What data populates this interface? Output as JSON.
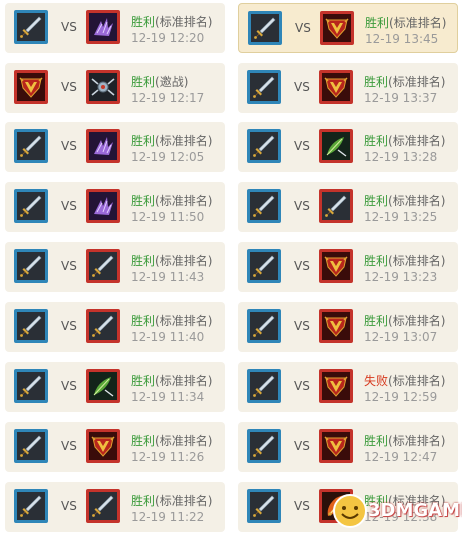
{
  "vs_label": "VS",
  "left_matches": [
    {
      "player_icon": "sword-icon",
      "player_border": "blue",
      "opponent_icon": "purple-claw-icon",
      "opponent_border": "red",
      "result": "胜利",
      "result_type": "win",
      "mode": "(标准排名)",
      "time": "12-19 12:20"
    },
    {
      "player_icon": "horde-crest-icon",
      "player_border": "red",
      "opponent_icon": "mech-spider-icon",
      "opponent_border": "red",
      "result": "胜利",
      "result_type": "win",
      "mode": "(邀战)",
      "time": "12-19 12:17"
    },
    {
      "player_icon": "sword-icon",
      "player_border": "blue",
      "opponent_icon": "purple-claw-icon",
      "opponent_border": "red",
      "result": "胜利",
      "result_type": "win",
      "mode": "(标准排名)",
      "time": "12-19 12:05"
    },
    {
      "player_icon": "sword-icon",
      "player_border": "blue",
      "opponent_icon": "purple-claw-icon",
      "opponent_border": "red",
      "result": "胜利",
      "result_type": "win",
      "mode": "(标准排名)",
      "time": "12-19 11:50"
    },
    {
      "player_icon": "sword-icon",
      "player_border": "blue",
      "opponent_icon": "sword-icon",
      "opponent_border": "red",
      "result": "胜利",
      "result_type": "win",
      "mode": "(标准排名)",
      "time": "12-19 11:43"
    },
    {
      "player_icon": "sword-icon",
      "player_border": "blue",
      "opponent_icon": "sword-icon",
      "opponent_border": "red",
      "result": "胜利",
      "result_type": "win",
      "mode": "(标准排名)",
      "time": "12-19 11:40"
    },
    {
      "player_icon": "sword-icon",
      "player_border": "blue",
      "opponent_icon": "green-leaf-icon",
      "opponent_border": "red",
      "result": "胜利",
      "result_type": "win",
      "mode": "(标准排名)",
      "time": "12-19 11:34"
    },
    {
      "player_icon": "sword-icon",
      "player_border": "blue",
      "opponent_icon": "horde-crest-icon",
      "opponent_border": "red",
      "result": "胜利",
      "result_type": "win",
      "mode": "(标准排名)",
      "time": "12-19 11:26"
    },
    {
      "player_icon": "sword-icon",
      "player_border": "blue",
      "opponent_icon": "sword-icon",
      "opponent_border": "red",
      "result": "胜利",
      "result_type": "win",
      "mode": "(标准排名)",
      "time": "12-19 11:22"
    }
  ],
  "right_matches": [
    {
      "player_icon": "sword-icon",
      "player_border": "blue",
      "opponent_icon": "horde-crest-icon",
      "opponent_border": "red",
      "result": "胜利",
      "result_type": "win",
      "mode": "(标准排名)",
      "time": "12-19 13:45",
      "highlight": true
    },
    {
      "player_icon": "sword-icon",
      "player_border": "blue",
      "opponent_icon": "horde-crest-icon",
      "opponent_border": "red",
      "result": "胜利",
      "result_type": "win",
      "mode": "(标准排名)",
      "time": "12-19 13:37"
    },
    {
      "player_icon": "sword-icon",
      "player_border": "blue",
      "opponent_icon": "green-leaf-icon",
      "opponent_border": "red",
      "result": "胜利",
      "result_type": "win",
      "mode": "(标准排名)",
      "time": "12-19 13:28"
    },
    {
      "player_icon": "sword-icon",
      "player_border": "blue",
      "opponent_icon": "sword-icon",
      "opponent_border": "red",
      "result": "胜利",
      "result_type": "win",
      "mode": "(标准排名)",
      "time": "12-19 13:25"
    },
    {
      "player_icon": "sword-icon",
      "player_border": "blue",
      "opponent_icon": "horde-crest-icon",
      "opponent_border": "red",
      "result": "胜利",
      "result_type": "win",
      "mode": "(标准排名)",
      "time": "12-19 13:23"
    },
    {
      "player_icon": "sword-icon",
      "player_border": "blue",
      "opponent_icon": "horde-crest-icon",
      "opponent_border": "red",
      "result": "胜利",
      "result_type": "win",
      "mode": "(标准排名)",
      "time": "12-19 13:07"
    },
    {
      "player_icon": "sword-icon",
      "player_border": "blue",
      "opponent_icon": "horde-crest-icon",
      "opponent_border": "red",
      "result": "失败",
      "result_type": "loss",
      "mode": "(标准排名)",
      "time": "12-19 12:59"
    },
    {
      "player_icon": "sword-icon",
      "player_border": "blue",
      "opponent_icon": "horde-crest-icon",
      "opponent_border": "red",
      "result": "胜利",
      "result_type": "win",
      "mode": "(标准排名)",
      "time": "12-19 12:47"
    },
    {
      "player_icon": "sword-icon",
      "player_border": "blue",
      "opponent_icon": "fire-sword-icon",
      "opponent_border": "red",
      "result": "胜利",
      "result_type": "win",
      "mode": "(标准排名)",
      "time": "12-19 12:38"
    }
  ],
  "watermark": {
    "text": "3DMGAME"
  },
  "colors": {
    "win": "#3a9a3a",
    "loss": "#d73a1f",
    "blue_border": "#2f86b8",
    "red_border": "#c4332b",
    "card_bg": "#f4f0e6"
  }
}
